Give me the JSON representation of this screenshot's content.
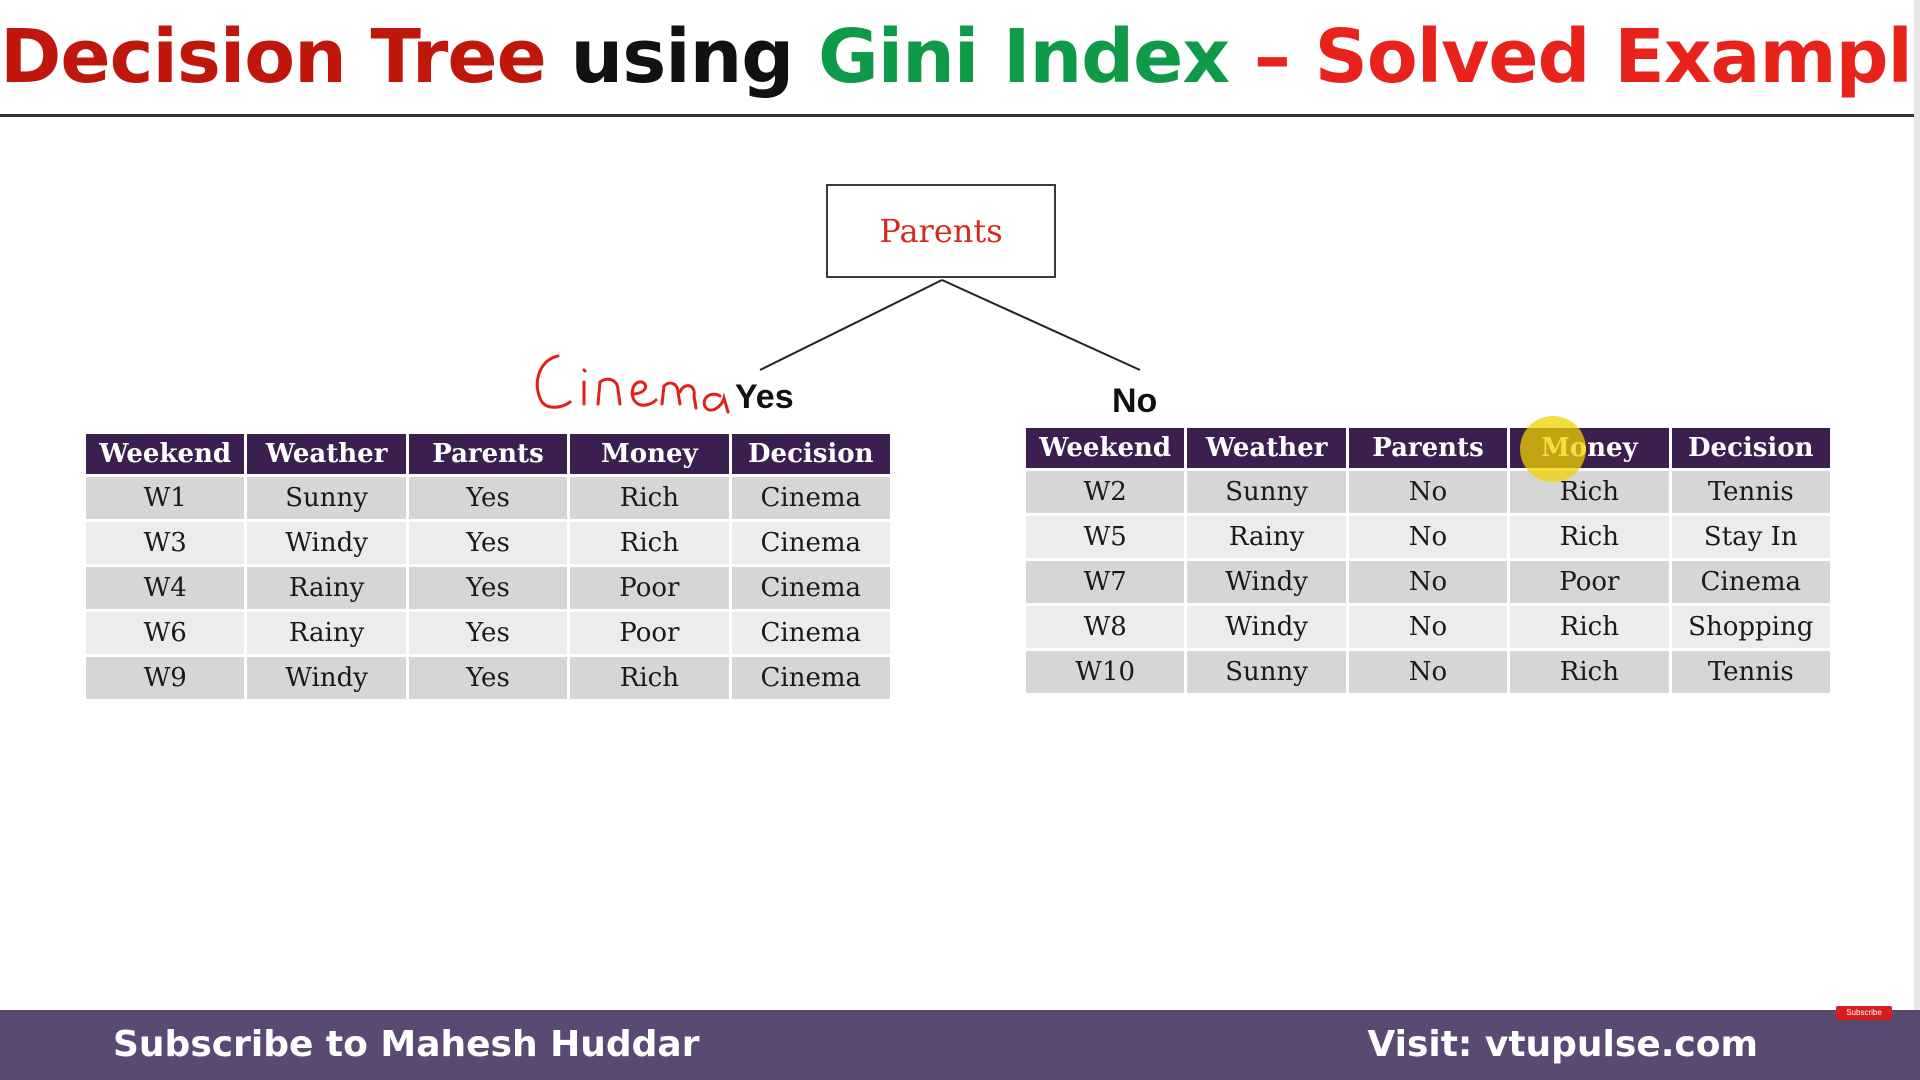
{
  "title": {
    "part1": "Decision Tree ",
    "part2": "using ",
    "part3": "Gini Index",
    "part4": " – Solved Example",
    "colors": {
      "part1": "#c0170d",
      "part2": "#111111",
      "part3": "#0f9a47",
      "part4": "#e8231b"
    }
  },
  "tree": {
    "root_label": "Parents",
    "branch_yes": "Yes",
    "branch_no": "No",
    "handwritten_annotation": "Cinema"
  },
  "table_headers": [
    "Weekend",
    "Weather",
    "Parents",
    "Money",
    "Decision"
  ],
  "left_table": {
    "rows": [
      [
        "W1",
        "Sunny",
        "Yes",
        "Rich",
        "Cinema"
      ],
      [
        "W3",
        "Windy",
        "Yes",
        "Rich",
        "Cinema"
      ],
      [
        "W4",
        "Rainy",
        "Yes",
        "Poor",
        "Cinema"
      ],
      [
        "W6",
        "Rainy",
        "Yes",
        "Poor",
        "Cinema"
      ],
      [
        "W9",
        "Windy",
        "Yes",
        "Rich",
        "Cinema"
      ]
    ]
  },
  "right_table": {
    "rows": [
      [
        "W2",
        "Sunny",
        "No",
        "Rich",
        "Tennis"
      ],
      [
        "W5",
        "Rainy",
        "No",
        "Rich",
        "Stay In"
      ],
      [
        "W7",
        "Windy",
        "No",
        "Poor",
        "Cinema"
      ],
      [
        "W8",
        "Windy",
        "No",
        "Rich",
        "Shopping"
      ],
      [
        "W10",
        "Sunny",
        "No",
        "Rich",
        "Tennis"
      ]
    ]
  },
  "footer": {
    "left": "Subscribe to Mahesh Huddar",
    "right": "Visit: vtupulse.com",
    "badge": "Subscribe"
  },
  "colors": {
    "header_bg": "#3b1f4e",
    "footer_bg": "#5a4a73",
    "root_text": "#d62a1e",
    "annotation_ink": "#e0201a"
  }
}
